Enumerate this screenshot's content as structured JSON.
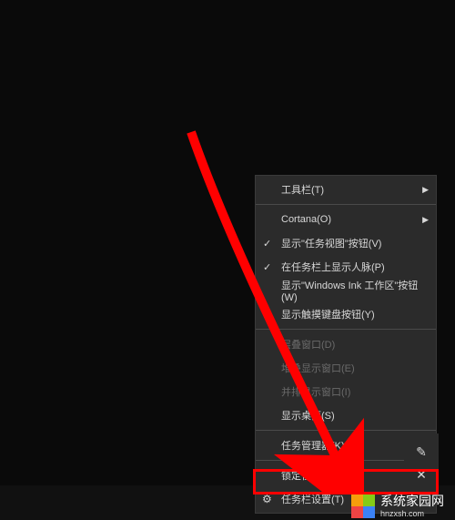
{
  "menu": {
    "items": [
      {
        "label": "工具栏(T)",
        "hasArrow": true
      },
      {
        "label": "Cortana(O)",
        "hasArrow": true
      },
      {
        "label": "显示\"任务视图\"按钮(V)",
        "checked": true
      },
      {
        "label": "在任务栏上显示人脉(P)",
        "checked": true
      },
      {
        "label": "显示\"Windows Ink 工作区\"按钮(W)"
      },
      {
        "label": "显示触摸键盘按钮(Y)"
      },
      {
        "label": "层叠窗口(D)",
        "disabled": true
      },
      {
        "label": "堆叠显示窗口(E)",
        "disabled": true
      },
      {
        "label": "并排显示窗口(I)",
        "disabled": true
      },
      {
        "label": "显示桌面(S)"
      },
      {
        "label": "任务管理器(K)"
      },
      {
        "label": "锁定任务栏(L)"
      },
      {
        "label": "任务栏设置(T)",
        "hasGear": true
      }
    ]
  },
  "watermark": {
    "title": "系统家园网",
    "url": "hnzxsh.com"
  },
  "colors": {
    "highlight": "#ff0000",
    "logoOrange": "#f59e0b",
    "logoGreen": "#84cc16",
    "logoBlue": "#3b82f6",
    "logoRed": "#ef4444"
  }
}
